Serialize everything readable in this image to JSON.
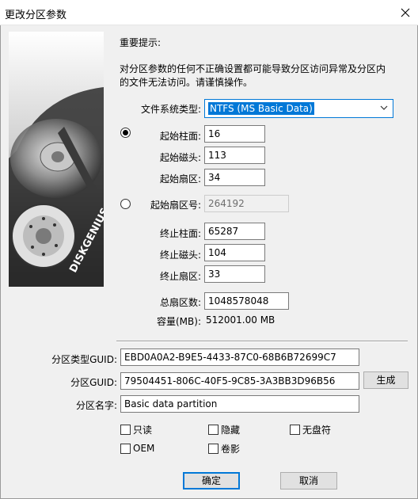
{
  "window": {
    "title": "更改分区参数"
  },
  "notice": {
    "heading": "重要提示:",
    "line1": "对分区参数的任何不正确设置都可能导致分区访问异常及分区内",
    "line2": "的文件无法访问。请谨慎操作。"
  },
  "fs_type": {
    "label": "文件系统类型:",
    "value": "NTFS (MS Basic Data)"
  },
  "chs": {
    "start_cylinder": {
      "label": "起始柱面:",
      "value": "16"
    },
    "start_head": {
      "label": "起始磁头:",
      "value": "113"
    },
    "start_sector": {
      "label": "起始扇区:",
      "value": "34"
    }
  },
  "lba": {
    "label": "起始扇区号:",
    "value": "264192"
  },
  "end": {
    "cylinder": {
      "label": "终止柱面:",
      "value": "65287"
    },
    "head": {
      "label": "终止磁头:",
      "value": "104"
    },
    "sector": {
      "label": "终止扇区:",
      "value": "33"
    }
  },
  "total_sectors": {
    "label": "总扇区数:",
    "value": "1048578048"
  },
  "capacity": {
    "label": "容量(MB):",
    "value": "512001.00 MB"
  },
  "type_guid": {
    "label": "分区类型GUID:",
    "value": "EBD0A0A2-B9E5-4433-87C0-68B6B72699C7"
  },
  "part_guid": {
    "label": "分区GUID:",
    "value": "79504451-806C-40F5-9C85-3A3BB3D96B56",
    "generate": "生成"
  },
  "part_name": {
    "label": "分区名字:",
    "value": "Basic data partition"
  },
  "flags": {
    "readonly": "只读",
    "hidden": "隐藏",
    "no_drive_letter": "无盘符",
    "oem": "OEM",
    "shadow": "卷影"
  },
  "buttons": {
    "ok": "确定",
    "cancel": "取消"
  },
  "brand": {
    "logo_text": "DISKGENIUS"
  },
  "colors": {
    "accent": "#0078d7"
  }
}
